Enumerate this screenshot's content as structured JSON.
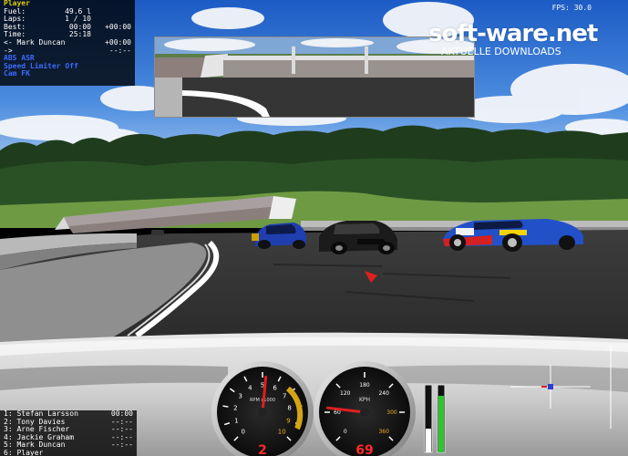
{
  "hud": {
    "title_fragment": "Player",
    "stats": [
      {
        "label": "Fuel:",
        "value": "49.6 l",
        "delta": ""
      },
      {
        "label": "Laps:",
        "value": "1 / 10",
        "delta": ""
      },
      {
        "label": "Best:",
        "value": "00:00",
        "delta": "+00:00"
      },
      {
        "label": "Time:",
        "value": "25:18",
        "delta": ""
      }
    ],
    "ahead": {
      "label": "<- Mark Duncan",
      "delta": "+00:00"
    },
    "behind": {
      "label": "->",
      "delta": "--:--"
    },
    "assists": [
      "ABS ASR",
      "Speed Limiter Off",
      "Cam FK"
    ]
  },
  "fps": "FPS: 30.0",
  "watermark": {
    "brand": "soft-ware.net",
    "tagline": "AKTUELLE DOWNLOADS"
  },
  "standings": [
    {
      "pos_name": "1: Stefan Larsson",
      "time": "00:00"
    },
    {
      "pos_name": "2: Tony Davies",
      "time": "--:--"
    },
    {
      "pos_name": "3: Arne Fischer",
      "time": "--:--"
    },
    {
      "pos_name": "4: Jackie Graham",
      "time": "--:--"
    },
    {
      "pos_name": "5: Mark Duncan",
      "time": "--:--"
    },
    {
      "pos_name": "6: Player",
      "time": ""
    }
  ],
  "tachometer": {
    "unit": "RPM x1000",
    "ticks": [
      "0",
      "1",
      "2",
      "3",
      "4",
      "5",
      "6",
      "7",
      "8",
      "9",
      "10"
    ],
    "gear": "2",
    "needle_value": 5.2
  },
  "speedometer": {
    "unit": "KPH",
    "ticks": [
      "0",
      "60",
      "120",
      "180",
      "240",
      "300",
      "360"
    ],
    "speed": "69",
    "needle_value": 69
  },
  "bars": {
    "left_fill": 0.35,
    "right_fill": 0.85
  },
  "colors": {
    "hud_bg": "#000000",
    "assist_text": "#3a6bff",
    "gauge_digits": "#ff2a2a",
    "car_blue": "#1f3fb0",
    "car_black": "#1b1b1b"
  }
}
